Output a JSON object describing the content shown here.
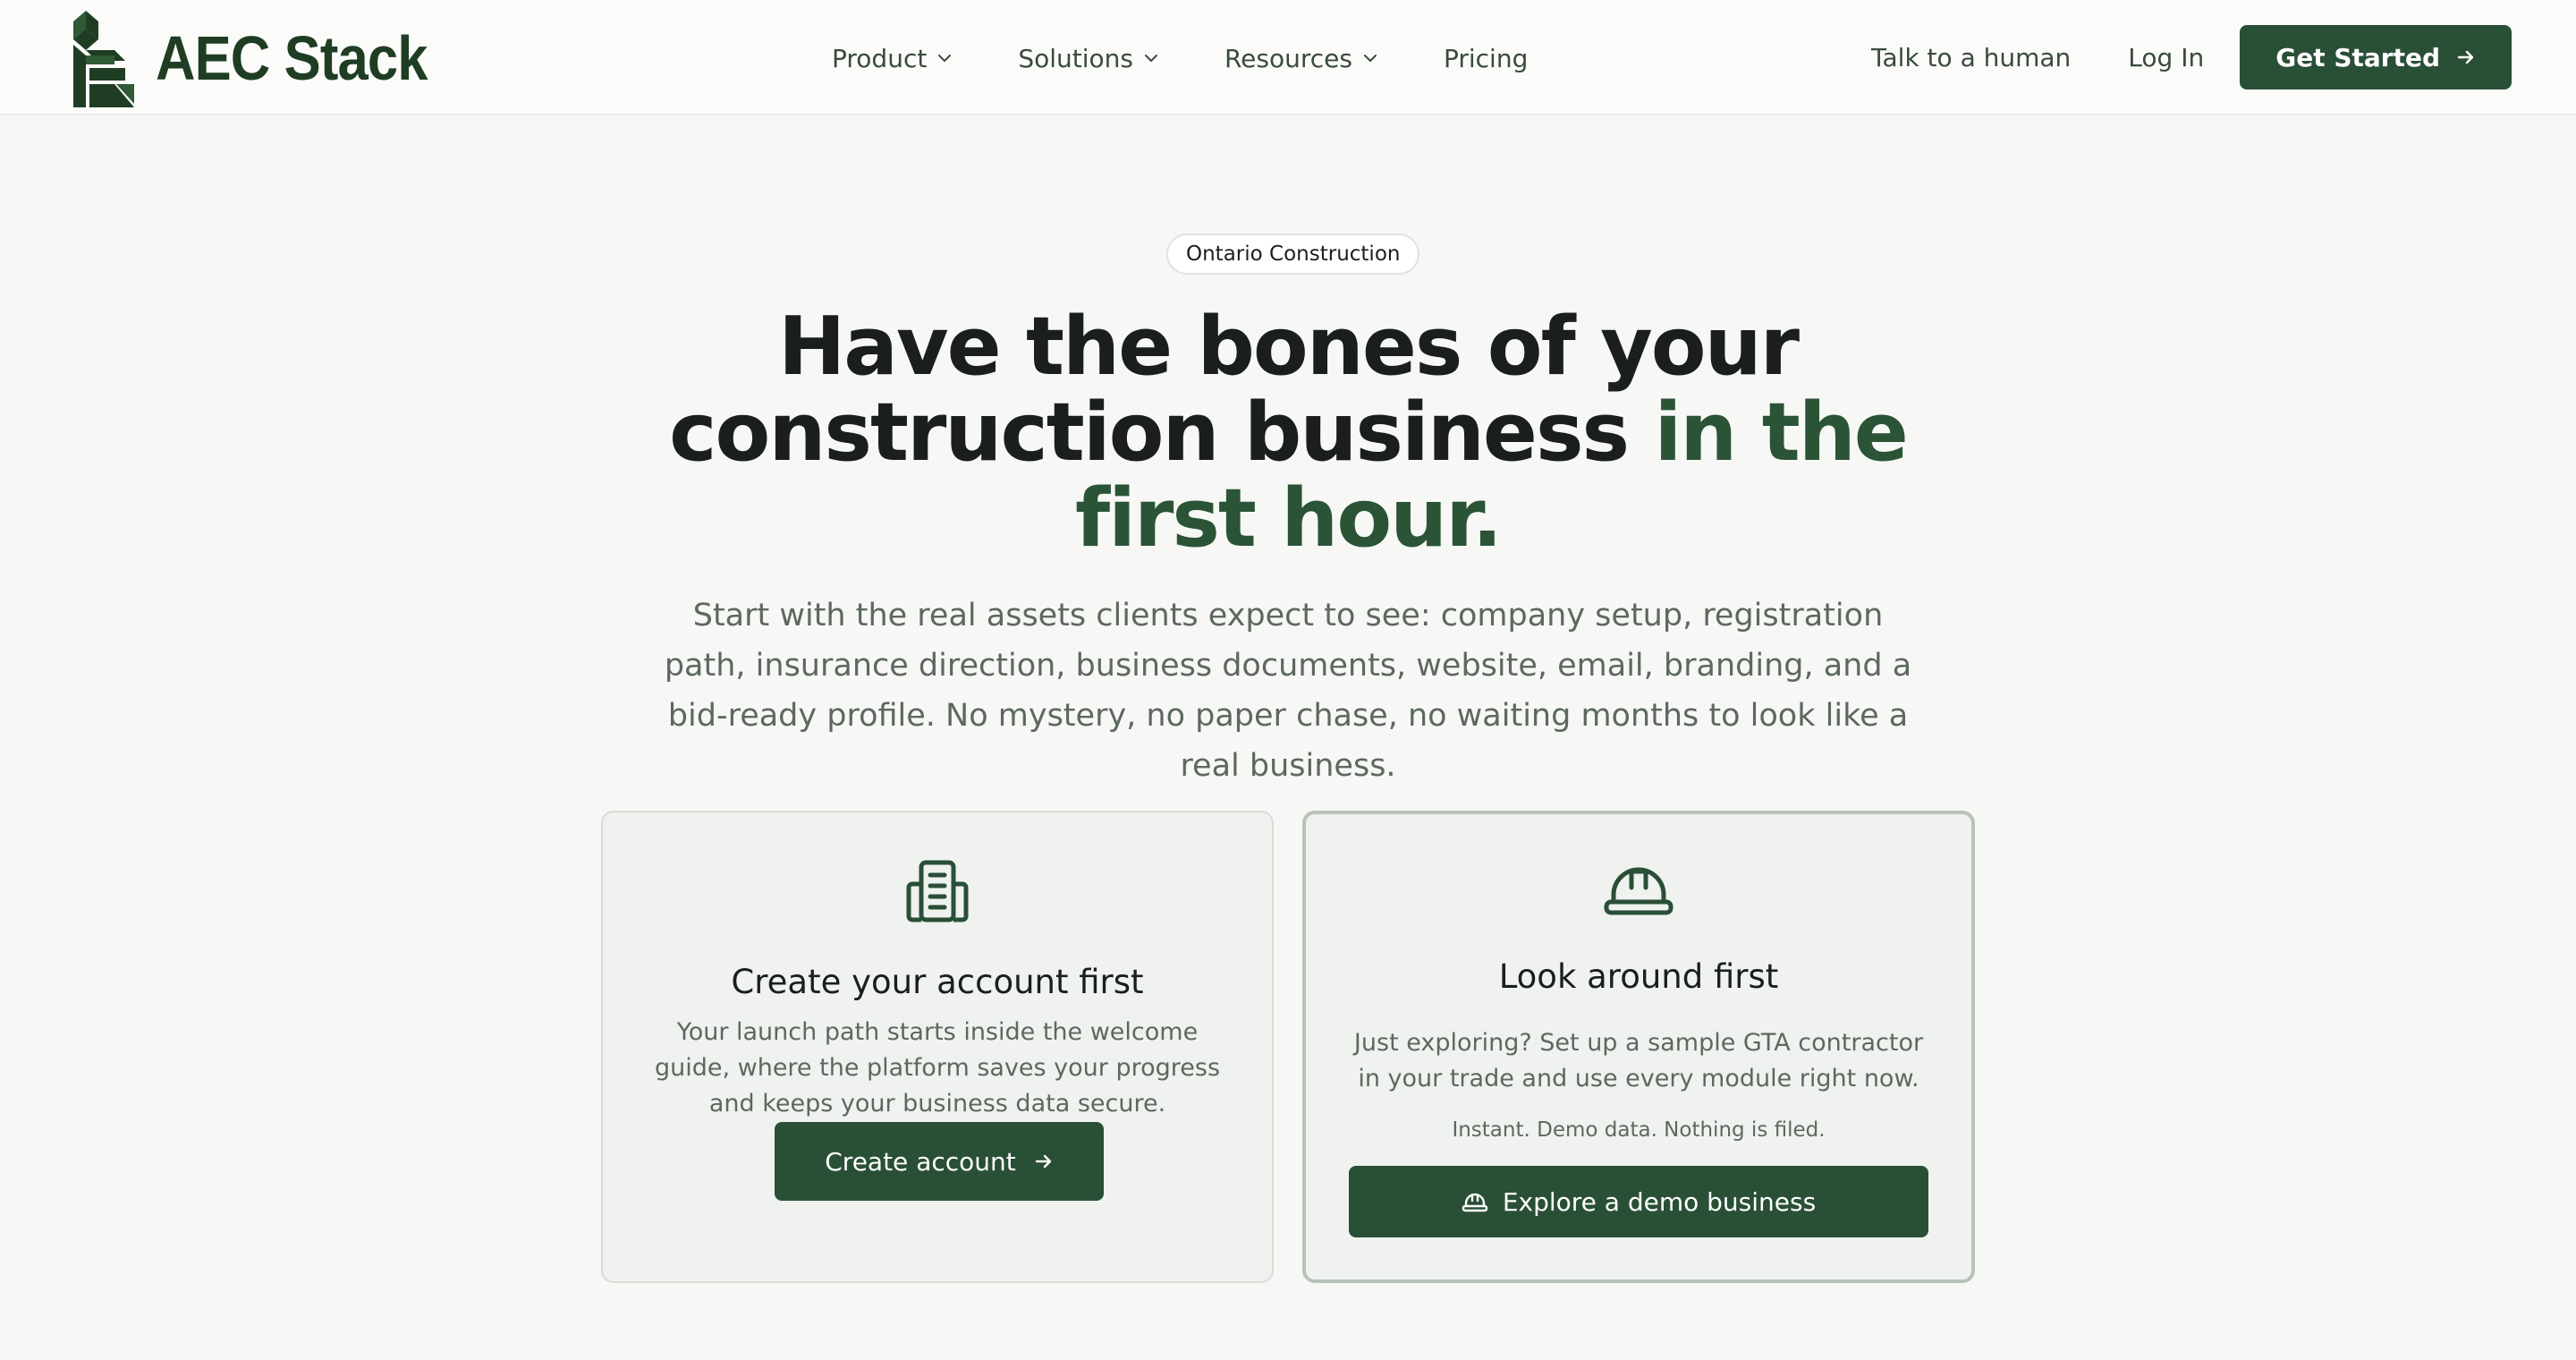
{
  "brand": {
    "name": "AEC Stack",
    "color": "#1f3d23"
  },
  "nav": {
    "links": [
      {
        "label": "Product",
        "has_menu": true
      },
      {
        "label": "Solutions",
        "has_menu": true
      },
      {
        "label": "Resources",
        "has_menu": true
      },
      {
        "label": "Pricing",
        "has_menu": false
      }
    ],
    "talk_label": "Talk to a human",
    "login_label": "Log In",
    "cta_label": "Get Started"
  },
  "hero": {
    "badge": "Ontario Construction",
    "headline_line1": "Have the bones of your",
    "headline_line2": "construction business",
    "headline_accent": "in the first hour.",
    "subtitle": "Start with the real assets clients expect to see: company setup, registration path, insurance direction, business documents, website, email, branding, and a bid-ready profile. No mystery, no paper chase, no waiting months to look like a real business."
  },
  "cards": {
    "account": {
      "icon": "building-icon",
      "title": "Create your account first",
      "description": "Your launch path starts inside the welcome guide, where the platform saves your progress and keeps your business data secure.",
      "button_label": "Create account"
    },
    "demo": {
      "icon": "hard-hat-icon",
      "title": "Look around first",
      "description": "Just exploring? Set up a sample GTA contractor in your trade and use every module right now.",
      "note": "Instant. Demo data. Nothing is filed.",
      "button_label": "Explore a demo business"
    }
  },
  "colors": {
    "accent": "#2a4f37",
    "headline_accent": "#2b5436",
    "background": "#f7f8f6"
  }
}
